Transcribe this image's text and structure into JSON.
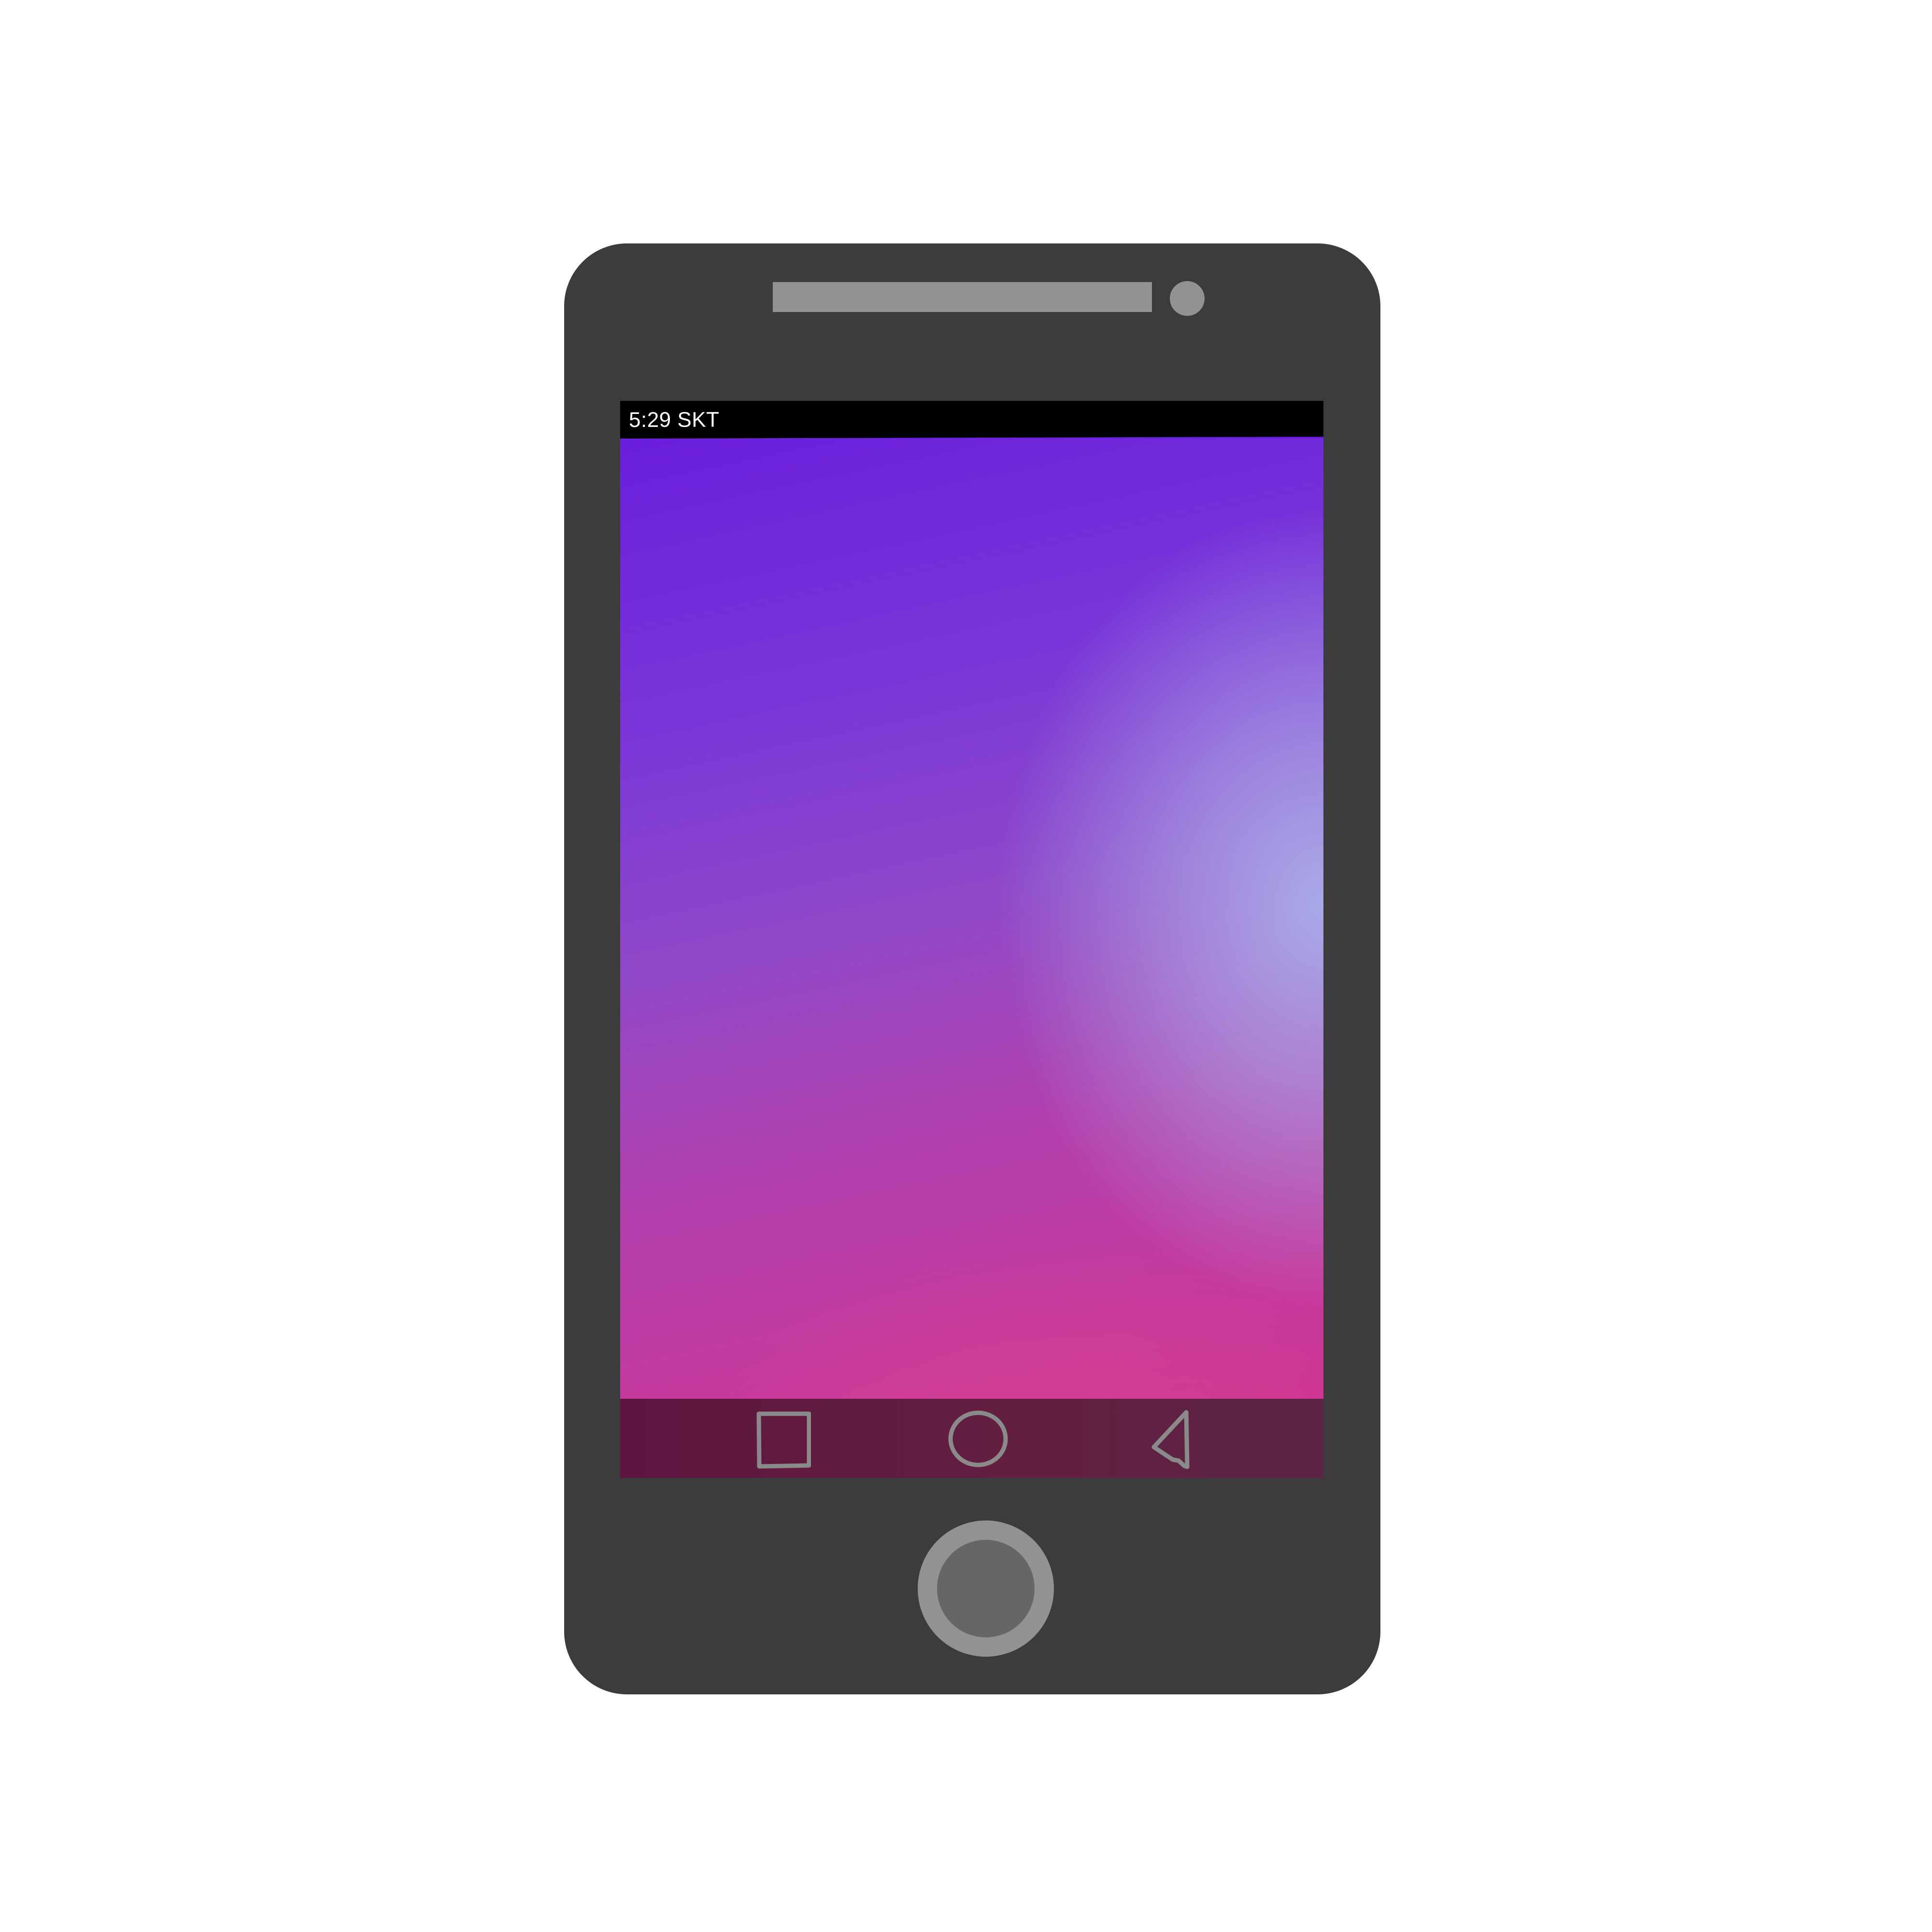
{
  "status_bar": {
    "text": "5:29 SKT"
  },
  "device": {
    "body_color": "#3c3c3c",
    "accent_gray": "#929292",
    "home_button_inner_color": "#666666"
  },
  "wallpaper": {
    "colors": [
      "#6a1edc",
      "#8f48c8",
      "#c63a9e",
      "#d2358e",
      "#aaafeb"
    ]
  },
  "nav_bar": {
    "color": "#5e1640",
    "icon_color": "#8a8a8a",
    "buttons": [
      {
        "icon": "square-recent-apps-icon"
      },
      {
        "icon": "circle-home-icon"
      },
      {
        "icon": "triangle-back-icon"
      }
    ]
  }
}
